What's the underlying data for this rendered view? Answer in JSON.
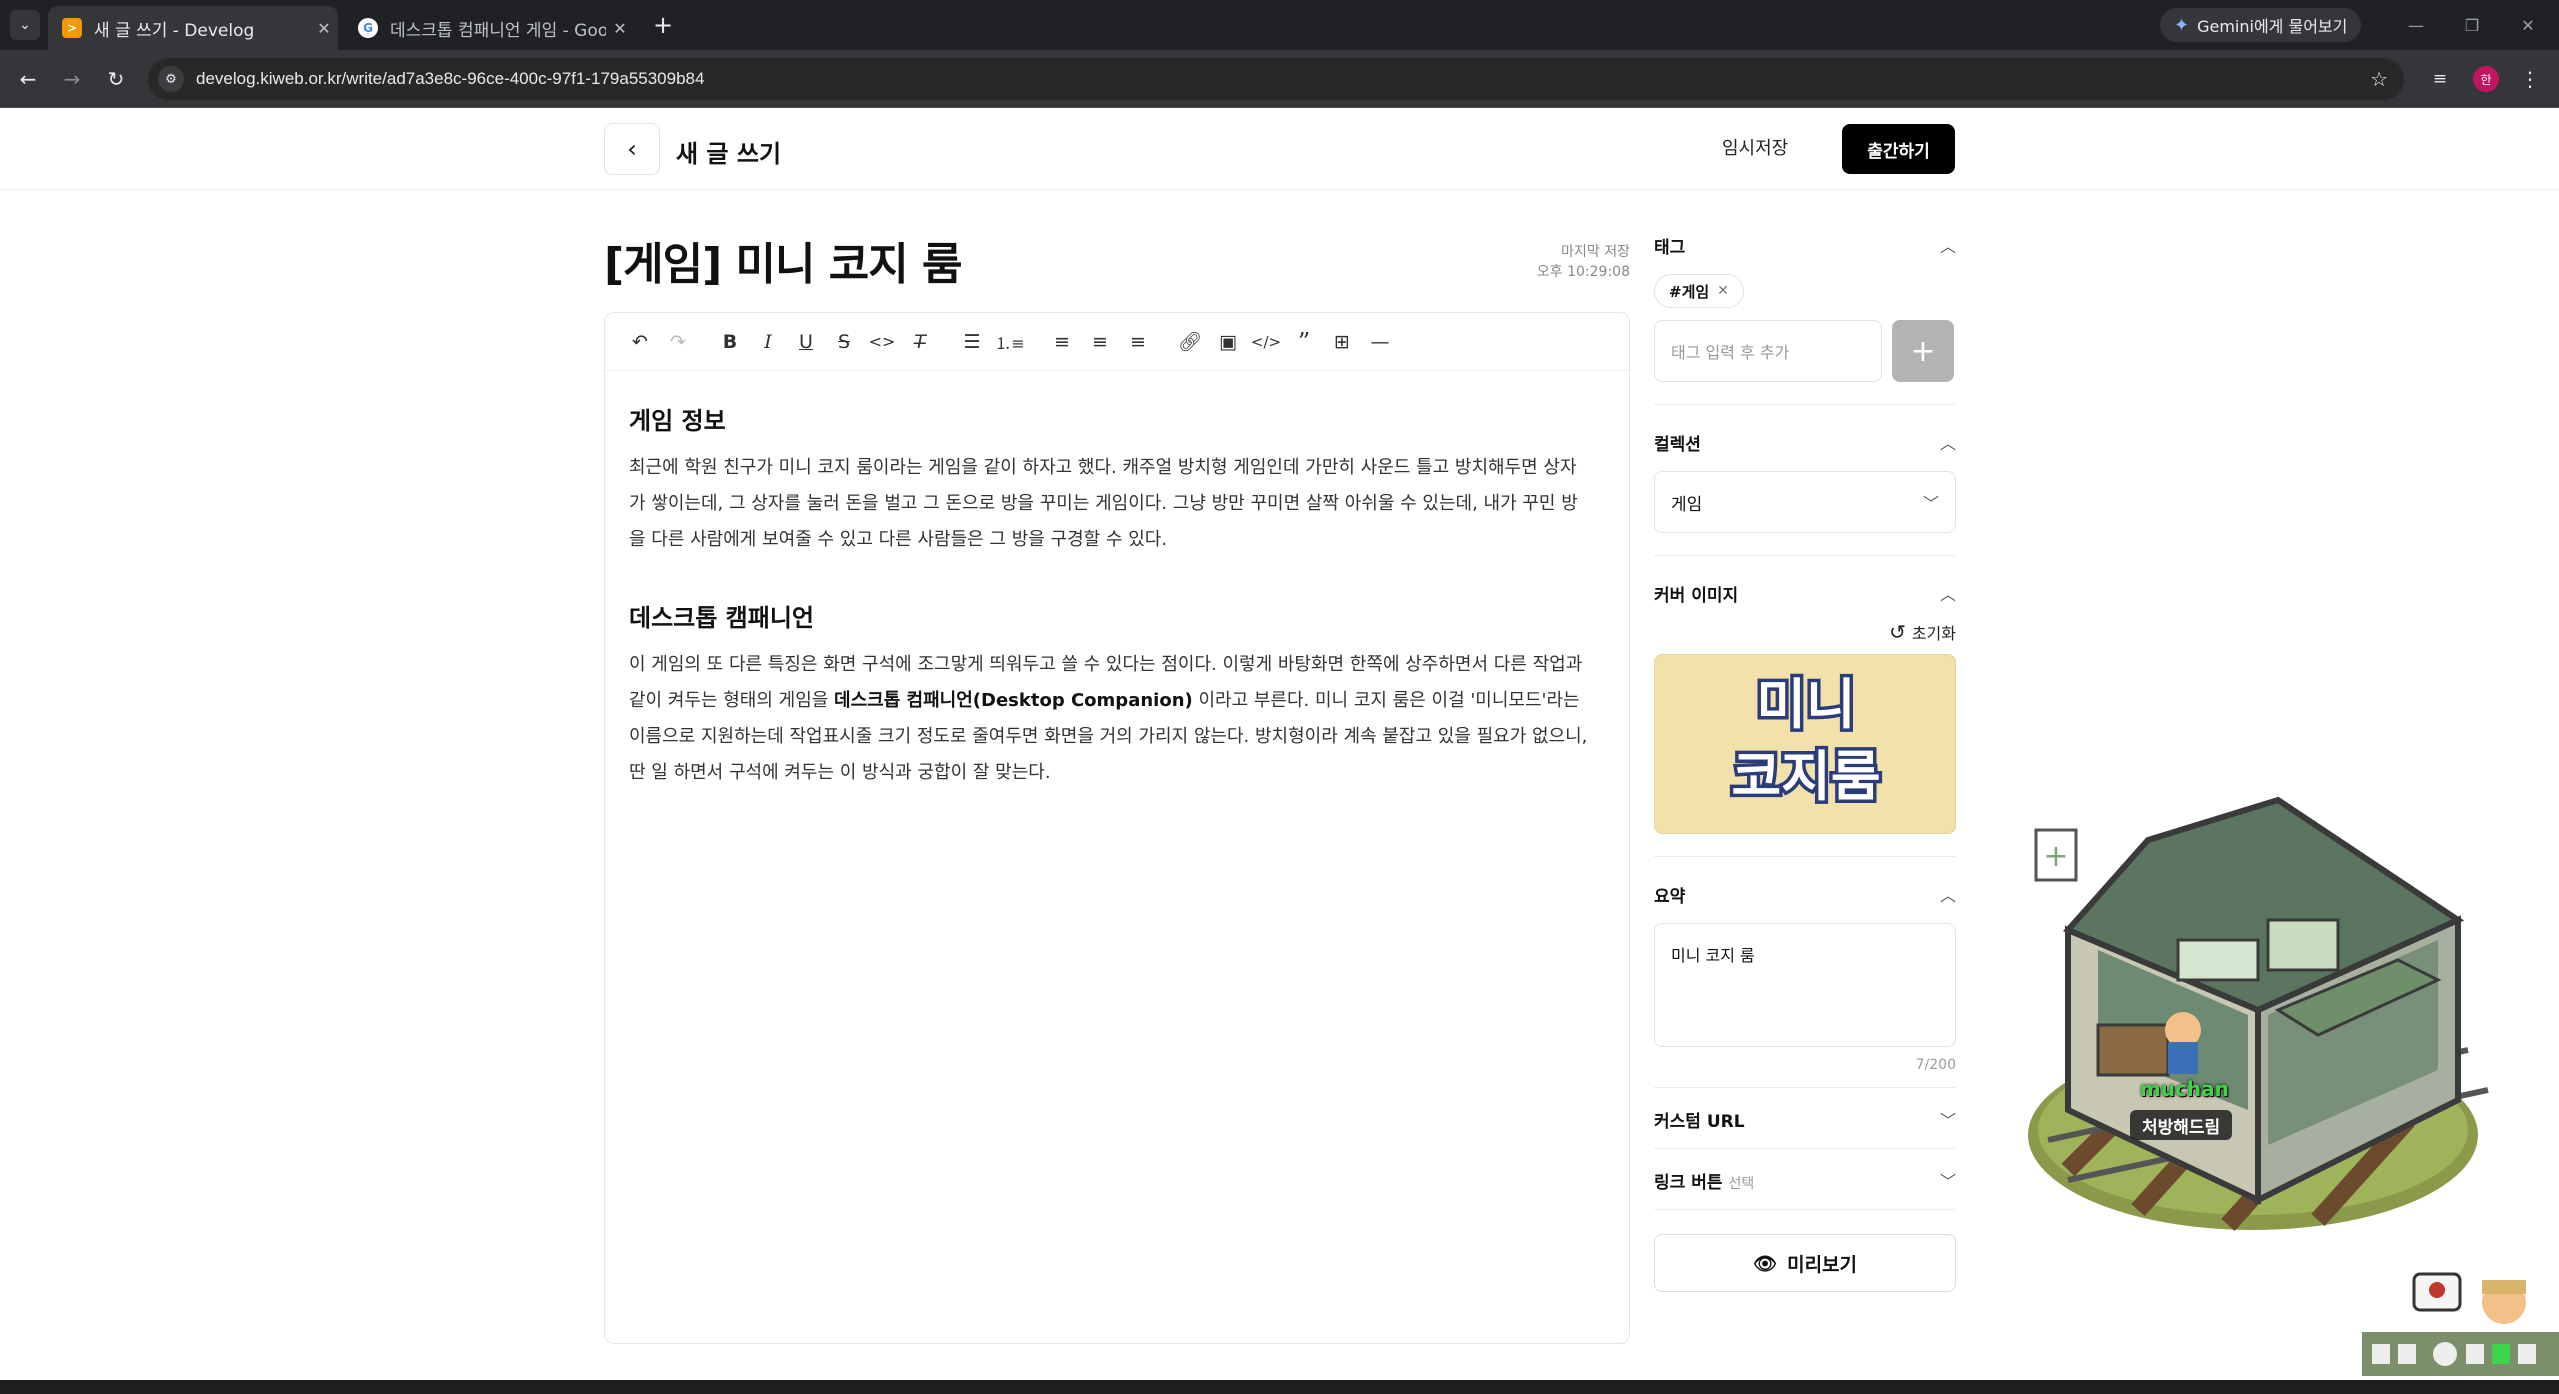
{
  "browser": {
    "tabs": [
      {
        "title": "새 글 쓰기 - Develog",
        "active": true
      },
      {
        "title": "데스크톱 컴패니언 게임 - Goo",
        "active": false
      }
    ],
    "gemini_label": "Gemini에게 물어보기",
    "url": "develog.kiweb.or.kr/write/ad7a3e8c-96ce-400c-97f1-179a55309b84",
    "profile_initial": "한"
  },
  "header": {
    "title": "새 글 쓰기",
    "draft_label": "임시저장",
    "publish_label": "출간하기"
  },
  "post": {
    "title": "[게임] 미니 코지 룸",
    "last_saved_label": "마지막 저장",
    "last_saved_time": "오후 10:29:08"
  },
  "content": {
    "heading1": "게임 정보",
    "para1": "최근에 학원 친구가 미니 코지 룸이라는 게임을 같이 하자고 했다. 캐주얼 방치형 게임인데 가만히 사운드 틀고 방치해두면 상자가 쌓이는데, 그 상자를 눌러 돈을 벌고 그 돈으로 방을 꾸미는 게임이다. 그냥 방만 꾸미면 살짝 아쉬울 수 있는데, 내가 꾸민 방을 다른 사람에게 보여줄 수 있고 다른 사람들은 그 방을 구경할 수 있다.",
    "heading2": "데스크톱 캠패니언",
    "para2_before": "이 게임의 또 다른 특징은 화면 구석에 조그맣게 띄워두고 쓸 수 있다는 점이다. 이렇게 바탕화면 한쪽에 상주하면서 다른 작업과 같이 켜두는 형태의 게임을 ",
    "para2_bold": "데스크톱 컴패니언(Desktop Companion)",
    "para2_after": " 이라고 부른다. 미니 코지 룸은 이걸 '미니모드'라는 이름으로 지원하는데 작업표시줄 크기 정도로 줄여두면 화면을 거의 가리지 않는다. 방치형이라 계속 붙잡고 있을 필요가 없으니, 딴 일 하면서 구석에 켜두는 이 방식과 궁합이 잘 맞는다."
  },
  "sidebar": {
    "tags_title": "태그",
    "tag_chip": "#게임",
    "tag_placeholder": "태그 입력 후 추가",
    "collection_title": "컬렉션",
    "collection_value": "게임",
    "cover_title": "커버 이미지",
    "reset_label": "초기화",
    "cover_text_line1": "미니",
    "cover_text_line2": "코지룸",
    "summary_title": "요약",
    "summary_value": "미니 코지 룸",
    "summary_counter": "7/200",
    "custom_url_title": "커스텀 URL",
    "link_button_title": "링크 버튼",
    "link_button_optional": "선택",
    "preview_label": "미리보기"
  },
  "companion": {
    "username": "muchan",
    "speech": "처방해드림"
  }
}
